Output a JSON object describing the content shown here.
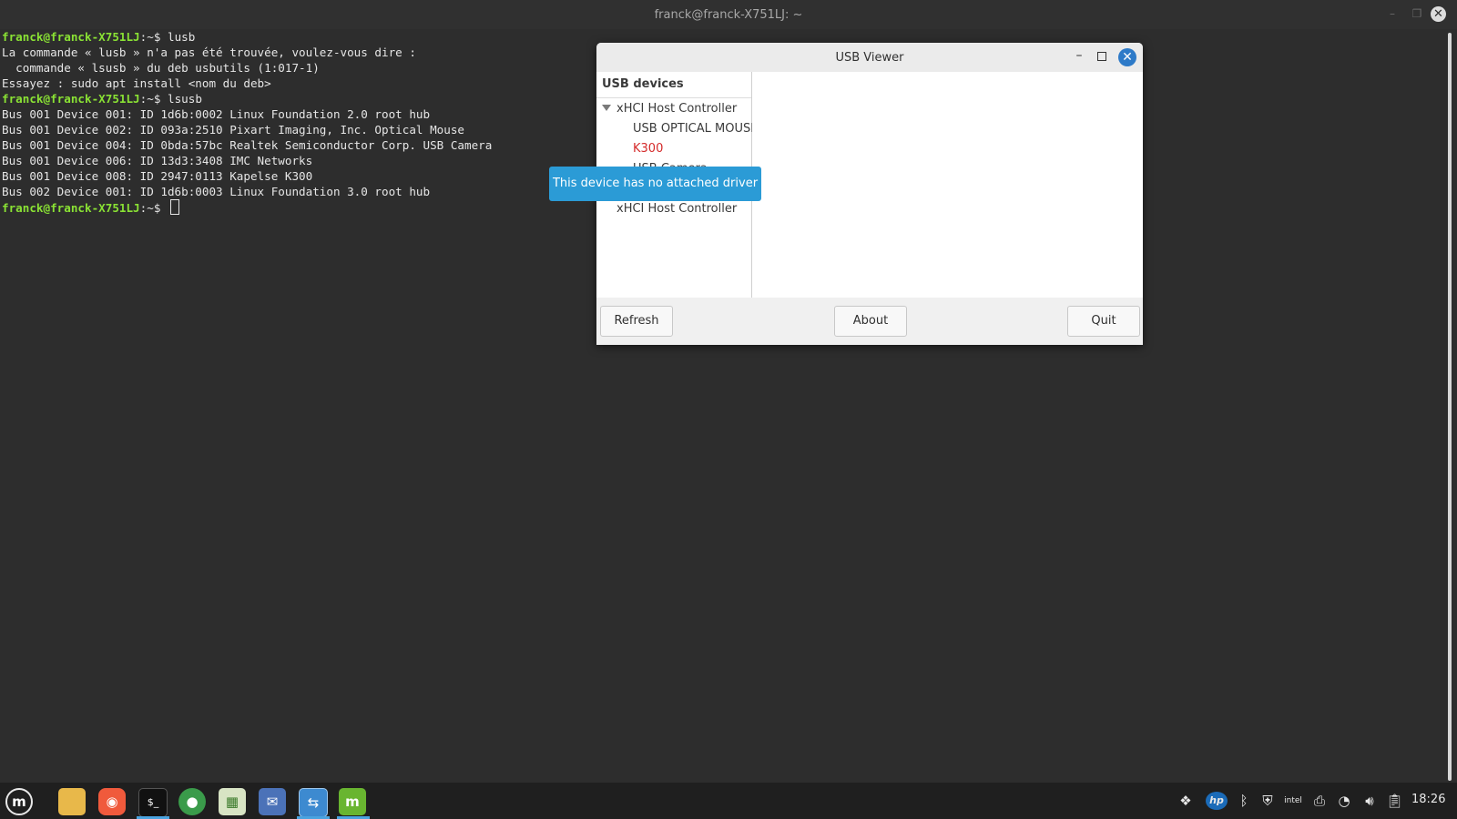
{
  "terminal": {
    "title": "franck@franck-X751LJ: ~",
    "lines": [
      {
        "prompt": "franck@franck-X751LJ",
        "rest": ":~$ lusb"
      },
      {
        "prompt": "",
        "rest": "La commande « lusb » n'a pas été trouvée, voulez-vous dire :"
      },
      {
        "prompt": "",
        "rest": "  commande « lsusb » du deb usbutils (1:017-1)"
      },
      {
        "prompt": "",
        "rest": "Essayez : sudo apt install <nom du deb>"
      },
      {
        "prompt": "franck@franck-X751LJ",
        "rest": ":~$ lsusb"
      },
      {
        "prompt": "",
        "rest": "Bus 001 Device 001: ID 1d6b:0002 Linux Foundation 2.0 root hub"
      },
      {
        "prompt": "",
        "rest": "Bus 001 Device 002: ID 093a:2510 Pixart Imaging, Inc. Optical Mouse"
      },
      {
        "prompt": "",
        "rest": "Bus 001 Device 004: ID 0bda:57bc Realtek Semiconductor Corp. USB Camera"
      },
      {
        "prompt": "",
        "rest": "Bus 001 Device 006: ID 13d3:3408 IMC Networks"
      },
      {
        "prompt": "",
        "rest": "Bus 001 Device 008: ID 2947:0113 Kapelse K300"
      },
      {
        "prompt": "",
        "rest": "Bus 002 Device 001: ID 1d6b:0003 Linux Foundation 3.0 root hub"
      },
      {
        "prompt": "franck@franck-X751LJ",
        "rest": ":~$ "
      }
    ]
  },
  "dialog": {
    "title": "USB Viewer",
    "tree_header": "USB devices",
    "tree": {
      "controller1": "xHCI Host Controller",
      "mouse": "USB OPTICAL MOUSE",
      "k300": "K300",
      "partial": "USB Camera",
      "controller2": "xHCI Host Controller"
    },
    "buttons": {
      "refresh": "Refresh",
      "about": "About",
      "quit": "Quit"
    },
    "tooltip": "This device has no attached driver",
    "warn_color": "#d42a2a",
    "accent": "#2b9bd6"
  },
  "taskbar": {
    "apps": [
      {
        "icon": "mint-menu-icon"
      },
      {
        "icon": "files-folder-icon"
      },
      {
        "icon": "firefox-icon"
      },
      {
        "icon": "terminal-icon"
      },
      {
        "icon": "chrome-icon"
      },
      {
        "icon": "spreadsheet-icon"
      },
      {
        "icon": "mail-icon"
      },
      {
        "icon": "usb-viewer-icon"
      },
      {
        "icon": "mint-update-icon"
      }
    ],
    "tray": [
      "dropbox-icon",
      "hp-icon",
      "bluetooth-icon",
      "shield-icon",
      "intel-icon",
      "printer-icon",
      "wifi-icon",
      "volume-icon",
      "clipboard-icon"
    ],
    "clock": "18:26"
  }
}
